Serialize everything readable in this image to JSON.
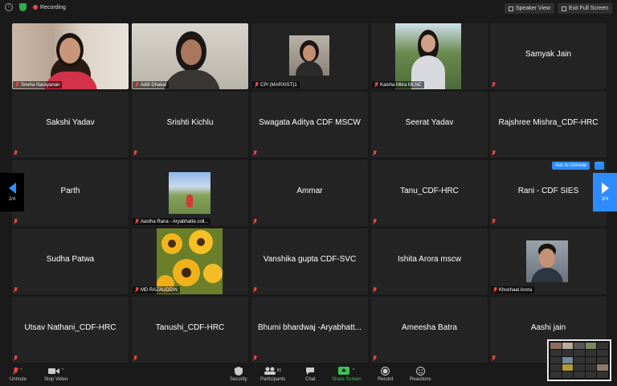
{
  "topbar": {
    "recording_label": "Recording",
    "speaker_view_label": "Speaker View",
    "exit_full_screen_label": "Exit Full Screen"
  },
  "participants": [
    {
      "name": "Sneha Narayanan",
      "style": "corner"
    },
    {
      "name": "Aditi Dhakal",
      "style": "corner"
    },
    {
      "name": "CPI (MARXIST)1",
      "style": "corner"
    },
    {
      "name": "Kaisha Mitra MLNC",
      "style": "corner"
    },
    {
      "name": "Samyak Jain",
      "style": "center"
    },
    {
      "name": "Sakshi Yadav",
      "style": "center"
    },
    {
      "name": "Srishti Kichlu",
      "style": "center"
    },
    {
      "name": "Swagata Aditya CDF MSCW",
      "style": "center"
    },
    {
      "name": "Seerat Yadav",
      "style": "center"
    },
    {
      "name": "Rajshree Mishra_CDF-HRC",
      "style": "center"
    },
    {
      "name": "Parth",
      "style": "center"
    },
    {
      "name": "Aastha Rana - Aryabhatta coll...",
      "style": "corner"
    },
    {
      "name": "Ammar",
      "style": "center"
    },
    {
      "name": "Tanu_CDF-HRC",
      "style": "center"
    },
    {
      "name": "Rani - CDF SIES",
      "style": "center"
    },
    {
      "name": "Sudha Patwa",
      "style": "center"
    },
    {
      "name": "MD RAZAUDDIN",
      "style": "corner"
    },
    {
      "name": "Vanshika gupta CDF-SVC",
      "style": "center"
    },
    {
      "name": "Ishita Arora  mscw",
      "style": "center"
    },
    {
      "name": "Khushaal Arora",
      "style": "corner"
    },
    {
      "name": "Utsav Nathani_CDF-HRC",
      "style": "center"
    },
    {
      "name": "Tanushi_CDF-HRC",
      "style": "center"
    },
    {
      "name": "Bhumi bhardwaj -Aryabhatt...",
      "style": "center"
    },
    {
      "name": "Ameesha Batra",
      "style": "center"
    },
    {
      "name": "Aashi jain",
      "style": "center"
    }
  ],
  "pager": {
    "left_page": "2/4",
    "right_page": "2/4"
  },
  "ask_to_unmute_label": "Ask to Unmute",
  "more_label": "···",
  "toolbar": {
    "unmute_label": "Unmute",
    "stop_video_label": "Stop Video",
    "security_label": "Security",
    "participants_label": "Participants",
    "participants_count": "81",
    "chat_label": "Chat",
    "share_screen_label": "Share Screen",
    "record_label": "Record",
    "reactions_label": "Reactions"
  },
  "colors": {
    "accent": "#2d8cff",
    "muted_red": "#e5483f",
    "share_green": "#3fbf5a"
  }
}
